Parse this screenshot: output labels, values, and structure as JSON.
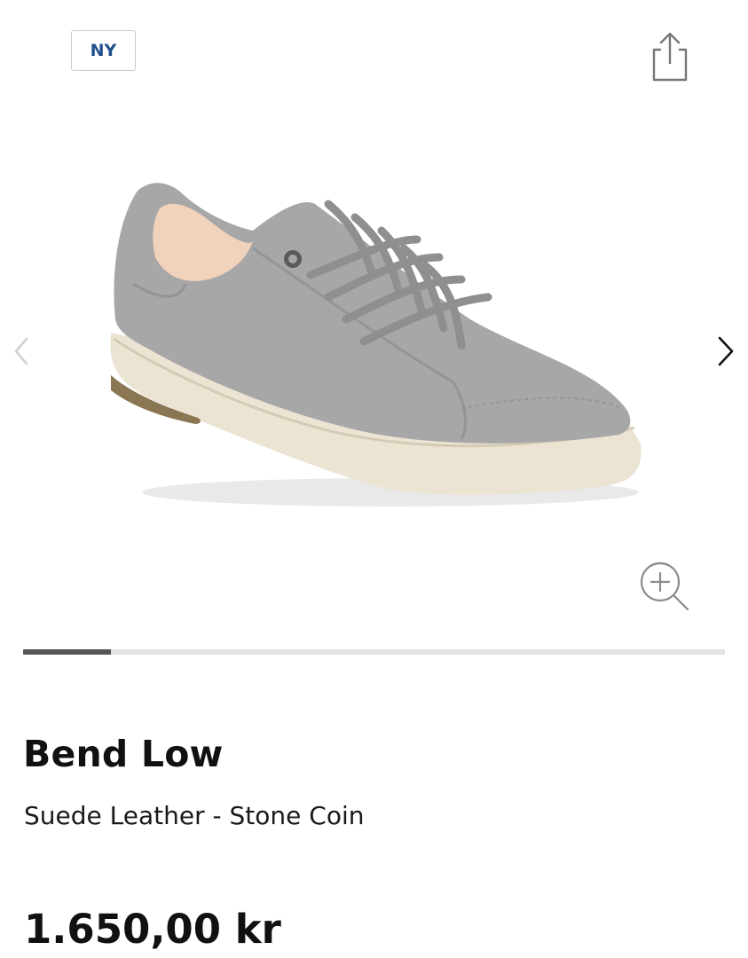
{
  "badge": {
    "label": "NY"
  },
  "icons": {
    "share": "share-icon",
    "prev": "chevron-left-icon",
    "next": "chevron-right-icon",
    "zoom": "zoom-in-icon"
  },
  "gallery": {
    "image_alt": "Bend Low",
    "progress": 0.125
  },
  "product": {
    "name": "Bend Low",
    "variant": "Suede Leather - Stone Coin",
    "price": "1.650,00 kr"
  },
  "colors": {
    "badge_text": "#1f4e8c",
    "progress_fill": "#555555",
    "progress_track": "#e3e3e3"
  }
}
